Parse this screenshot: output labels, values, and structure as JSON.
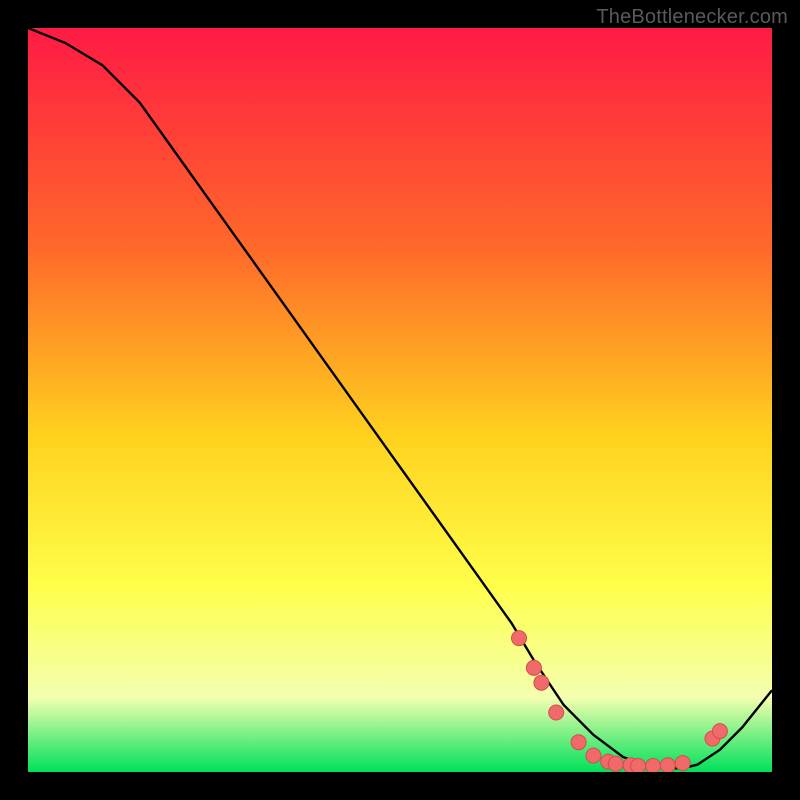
{
  "watermark": "TheBottlenecker.com",
  "colors": {
    "gradient_top": "#ff1a44",
    "gradient_mid1": "#ff6a2a",
    "gradient_mid2": "#ffd21e",
    "gradient_mid3": "#ffff4a",
    "gradient_mid4": "#f3ffb0",
    "gradient_bottom": "#00e05a",
    "curve": "#000000",
    "marker_fill": "#f06a6a",
    "marker_stroke": "#d84a4a"
  },
  "chart_data": {
    "type": "line",
    "title": "",
    "xlabel": "",
    "ylabel": "",
    "xlim": [
      0,
      100
    ],
    "ylim": [
      0,
      100
    ],
    "series": [
      {
        "name": "bottleneck-curve",
        "x": [
          0,
          5,
          10,
          15,
          20,
          25,
          30,
          35,
          40,
          45,
          50,
          55,
          60,
          65,
          68,
          72,
          76,
          80,
          83,
          86,
          88,
          90,
          93,
          96,
          100
        ],
        "y": [
          100,
          98,
          95,
          90,
          83,
          76,
          69,
          62,
          55,
          48,
          41,
          34,
          27,
          20,
          15,
          9,
          5,
          2,
          1,
          0.5,
          0.5,
          1,
          3,
          6,
          11
        ]
      }
    ],
    "markers": {
      "name": "highlight-points",
      "x_pct": [
        66,
        68,
        69,
        71,
        74,
        76,
        78,
        79,
        81,
        82,
        84,
        86,
        88,
        92,
        93
      ],
      "y_val": [
        18,
        14,
        12,
        8,
        4,
        2.2,
        1.4,
        1.1,
        0.9,
        0.8,
        0.8,
        0.9,
        1.2,
        4.5,
        5.5
      ]
    }
  }
}
